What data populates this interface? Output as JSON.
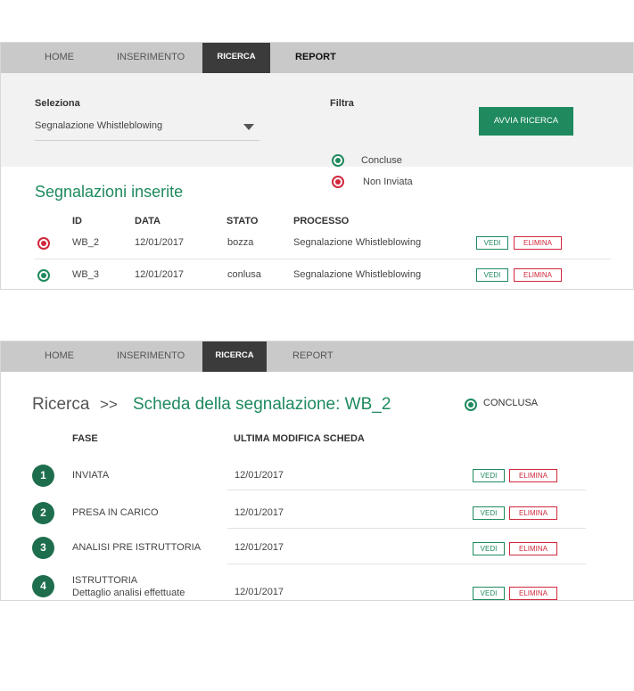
{
  "nav": {
    "home": "HOME",
    "inserimento": "INSERIMENTO",
    "ricerca": "RICERCA",
    "report": "REPORT"
  },
  "search": {
    "seleziona_label": "Seleziona",
    "select_value": "Segnalazione Whistleblowing",
    "filtra_label": "Filtra",
    "filters": [
      {
        "label": "Concluse",
        "color": "#1e8a5e"
      },
      {
        "label": "Non Inviata",
        "color": "#d0283c"
      }
    ],
    "button_label": "AVVIA RICERCA"
  },
  "results": {
    "title": "Segnalazioni inserite",
    "columns": [
      "ID",
      "DATA",
      "STATO",
      "PROCESSO"
    ],
    "rows": [
      {
        "id": "WB_2",
        "data": "12/01/2017",
        "stato": "bozza",
        "processo": "Segnalazione Whistleblowing",
        "status_color": "#d0283c"
      },
      {
        "id": "WB_3",
        "data": "12/01/2017",
        "stato": "conlusa",
        "processo": "Segnalazione Whistleblowing",
        "status_color": "#1e8a5e"
      }
    ]
  },
  "actions": {
    "vedi": "VEDI",
    "elimina": "ELIMINA"
  },
  "detail": {
    "breadcrumb_root": "Ricerca",
    "breadcrumb_sep": ">>",
    "breadcrumb_current": "Scheda della segnalazione: WB_2",
    "status": "CONCLUSA",
    "columns": [
      "FASE",
      "ULTIMA MODIFICA SCHEDA"
    ],
    "steps": [
      {
        "num": "1",
        "fase": "INVIATA",
        "sub": "",
        "date": "12/01/2017"
      },
      {
        "num": "2",
        "fase": "PRESA IN CARICO",
        "sub": "",
        "date": "12/01/2017"
      },
      {
        "num": "3",
        "fase": "ANALISI PRE ISTRUTTORIA",
        "sub": "",
        "date": "12/01/2017"
      },
      {
        "num": "4",
        "fase": "ISTRUTTORIA",
        "sub": "Dettaglio analisi effettuate",
        "date": "12/01/2017"
      }
    ]
  },
  "colors": {
    "accent": "#1e8a5e",
    "danger": "#d0283c",
    "nav_bg": "#c9c9c9",
    "nav_active": "#3b3b3b"
  }
}
